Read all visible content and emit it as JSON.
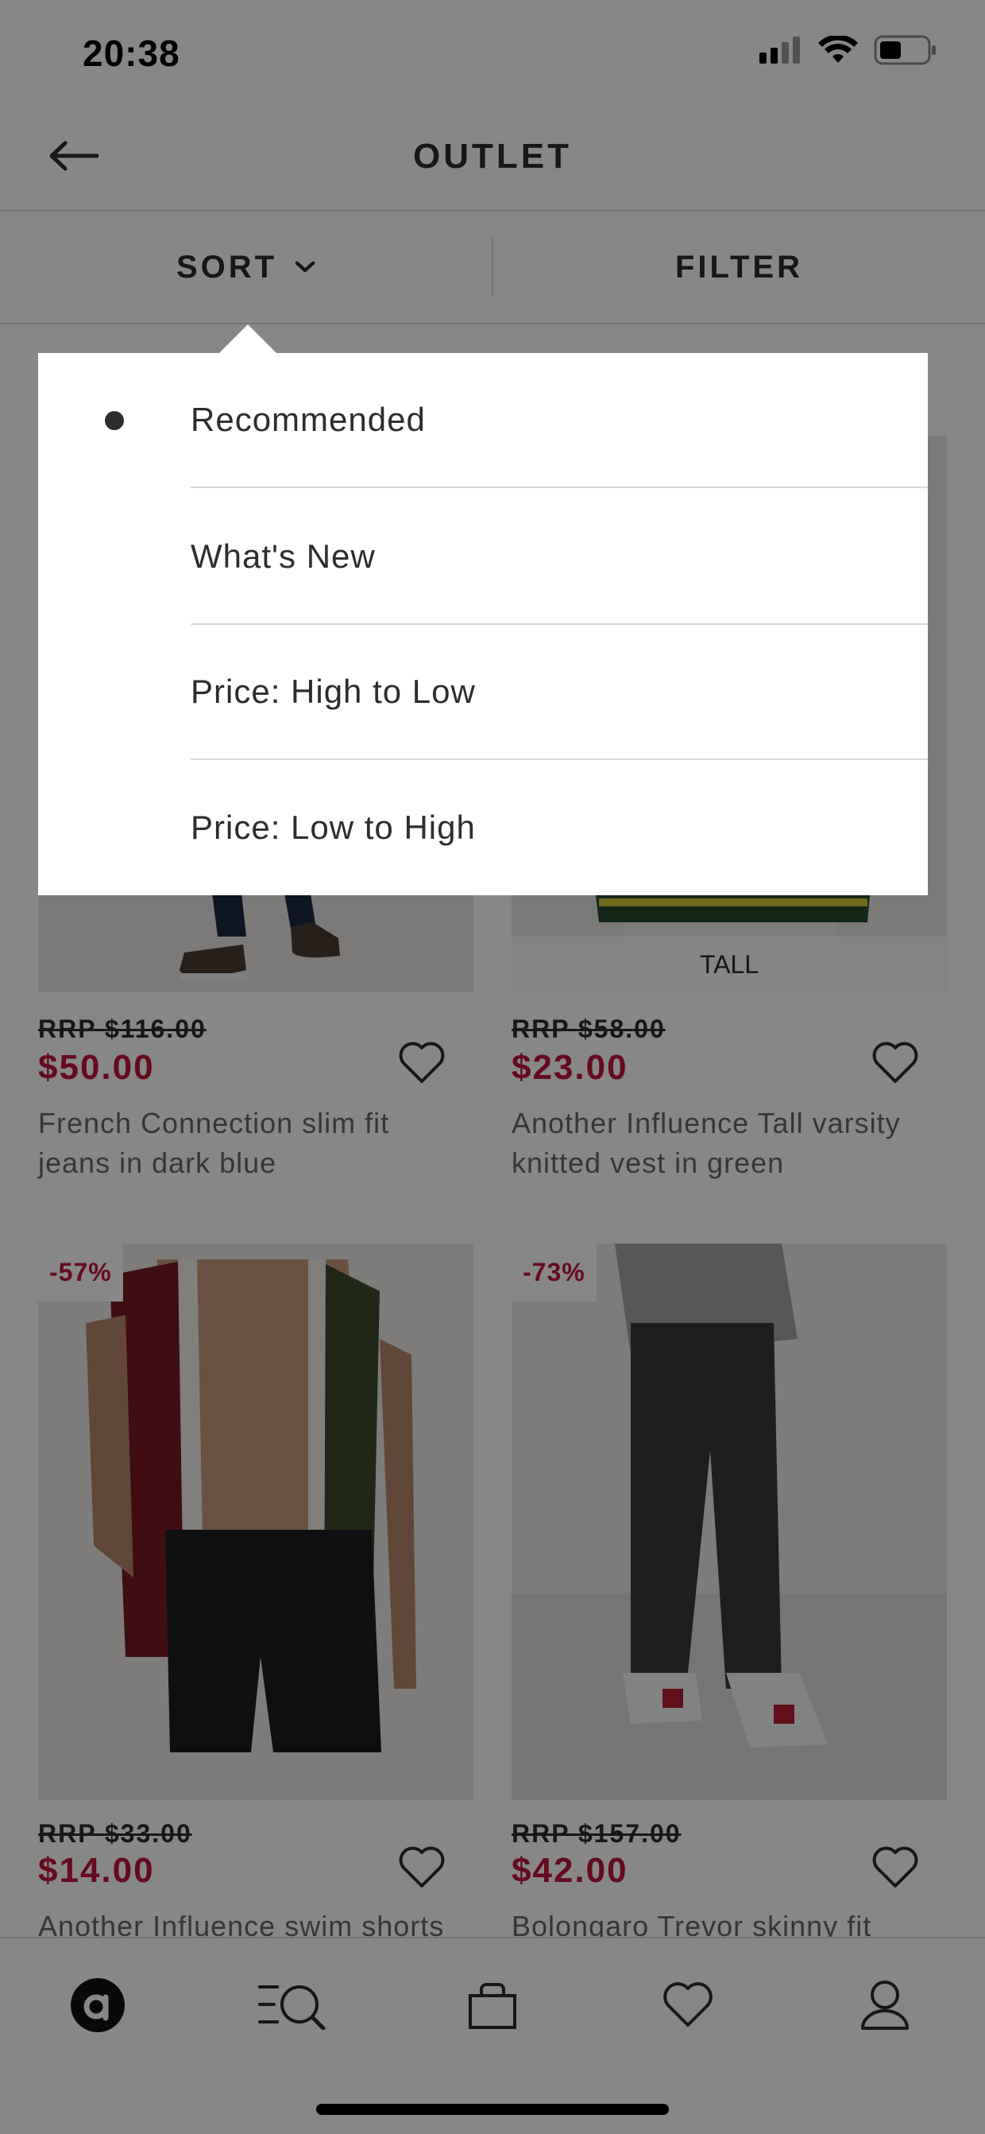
{
  "status_bar": {
    "time": "20:38"
  },
  "header": {
    "title": "OUTLET"
  },
  "sort_bar": {
    "sort_label": "SORT",
    "filter_label": "FILTER"
  },
  "sort_menu": {
    "selected_index": 0,
    "options": [
      "Recommended",
      "What's New",
      "Price: High to Low",
      "Price: Low to High"
    ]
  },
  "products": [
    {
      "rrp": "RRP $116.00",
      "price": "$50.00",
      "name_line1": "French Connection slim fit",
      "name_line2": "jeans in dark blue",
      "badge": "",
      "tag": ""
    },
    {
      "rrp": "RRP $58.00",
      "price": "$23.00",
      "name_line1": "Another Influence Tall varsity",
      "name_line2": "knitted vest in green",
      "badge": "",
      "tag": "TALL"
    },
    {
      "rrp": "RRP $33.00",
      "price": "$14.00",
      "name_line1": "Another Influence swim shorts",
      "name_line2": "",
      "badge": "-57%",
      "tag": ""
    },
    {
      "rrp": "RRP $157.00",
      "price": "$42.00",
      "name_line1": "Bolongaro Trevor skinny fit",
      "name_line2": "",
      "badge": "-73%",
      "tag": ""
    }
  ],
  "bottom_nav": [
    "home-icon",
    "search-icon",
    "bag-icon",
    "saved-icon",
    "account-icon"
  ],
  "colors": {
    "accent_price": "#c0143c",
    "text": "#2d2d2d",
    "overlay": "rgba(0,0,0,0.47)"
  }
}
